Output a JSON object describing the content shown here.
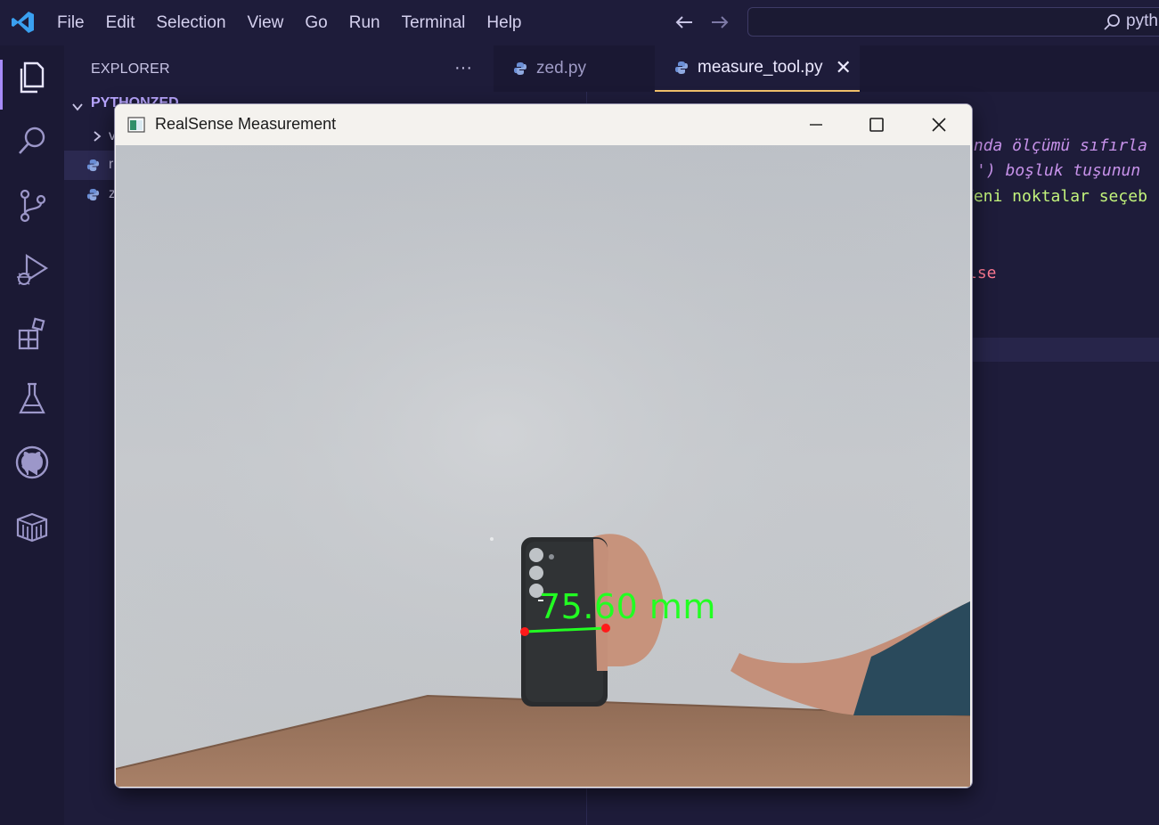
{
  "titlebar": {
    "menu": [
      "File",
      "Edit",
      "Selection",
      "View",
      "Go",
      "Run",
      "Terminal",
      "Help"
    ],
    "search_text": "pyth"
  },
  "activity_bar": {
    "icons": [
      "explorer-icon",
      "search-icon",
      "source-control-icon",
      "run-debug-icon",
      "extensions-icon",
      "testing-icon",
      "github-icon",
      "remote-explorer-icon"
    ]
  },
  "sidebar": {
    "title": "EXPLORER",
    "more": "···",
    "folder_label": "PYTHONZED",
    "rows": [
      "v",
      "r",
      "z"
    ]
  },
  "tabs": [
    {
      "label": "zed.py",
      "active": false
    },
    {
      "label": "measure_tool.py",
      "active": true,
      "close": "✕"
    }
  ],
  "code_fragments": {
    "line1": "anda ölçümü sıfırla",
    "line2": "') boşluk tuşunun",
    "line3": "Yeni noktalar seçeb",
    "line4": "lse"
  },
  "window": {
    "title": "RealSense Measurement",
    "minimize": "minimize",
    "maximize": "maximize",
    "close": "close",
    "measurement_label": "75.60 mm"
  },
  "colors": {
    "accent": "#a78bfa",
    "measure_text": "#22ff22",
    "measure_point": "#ff1a1a"
  }
}
